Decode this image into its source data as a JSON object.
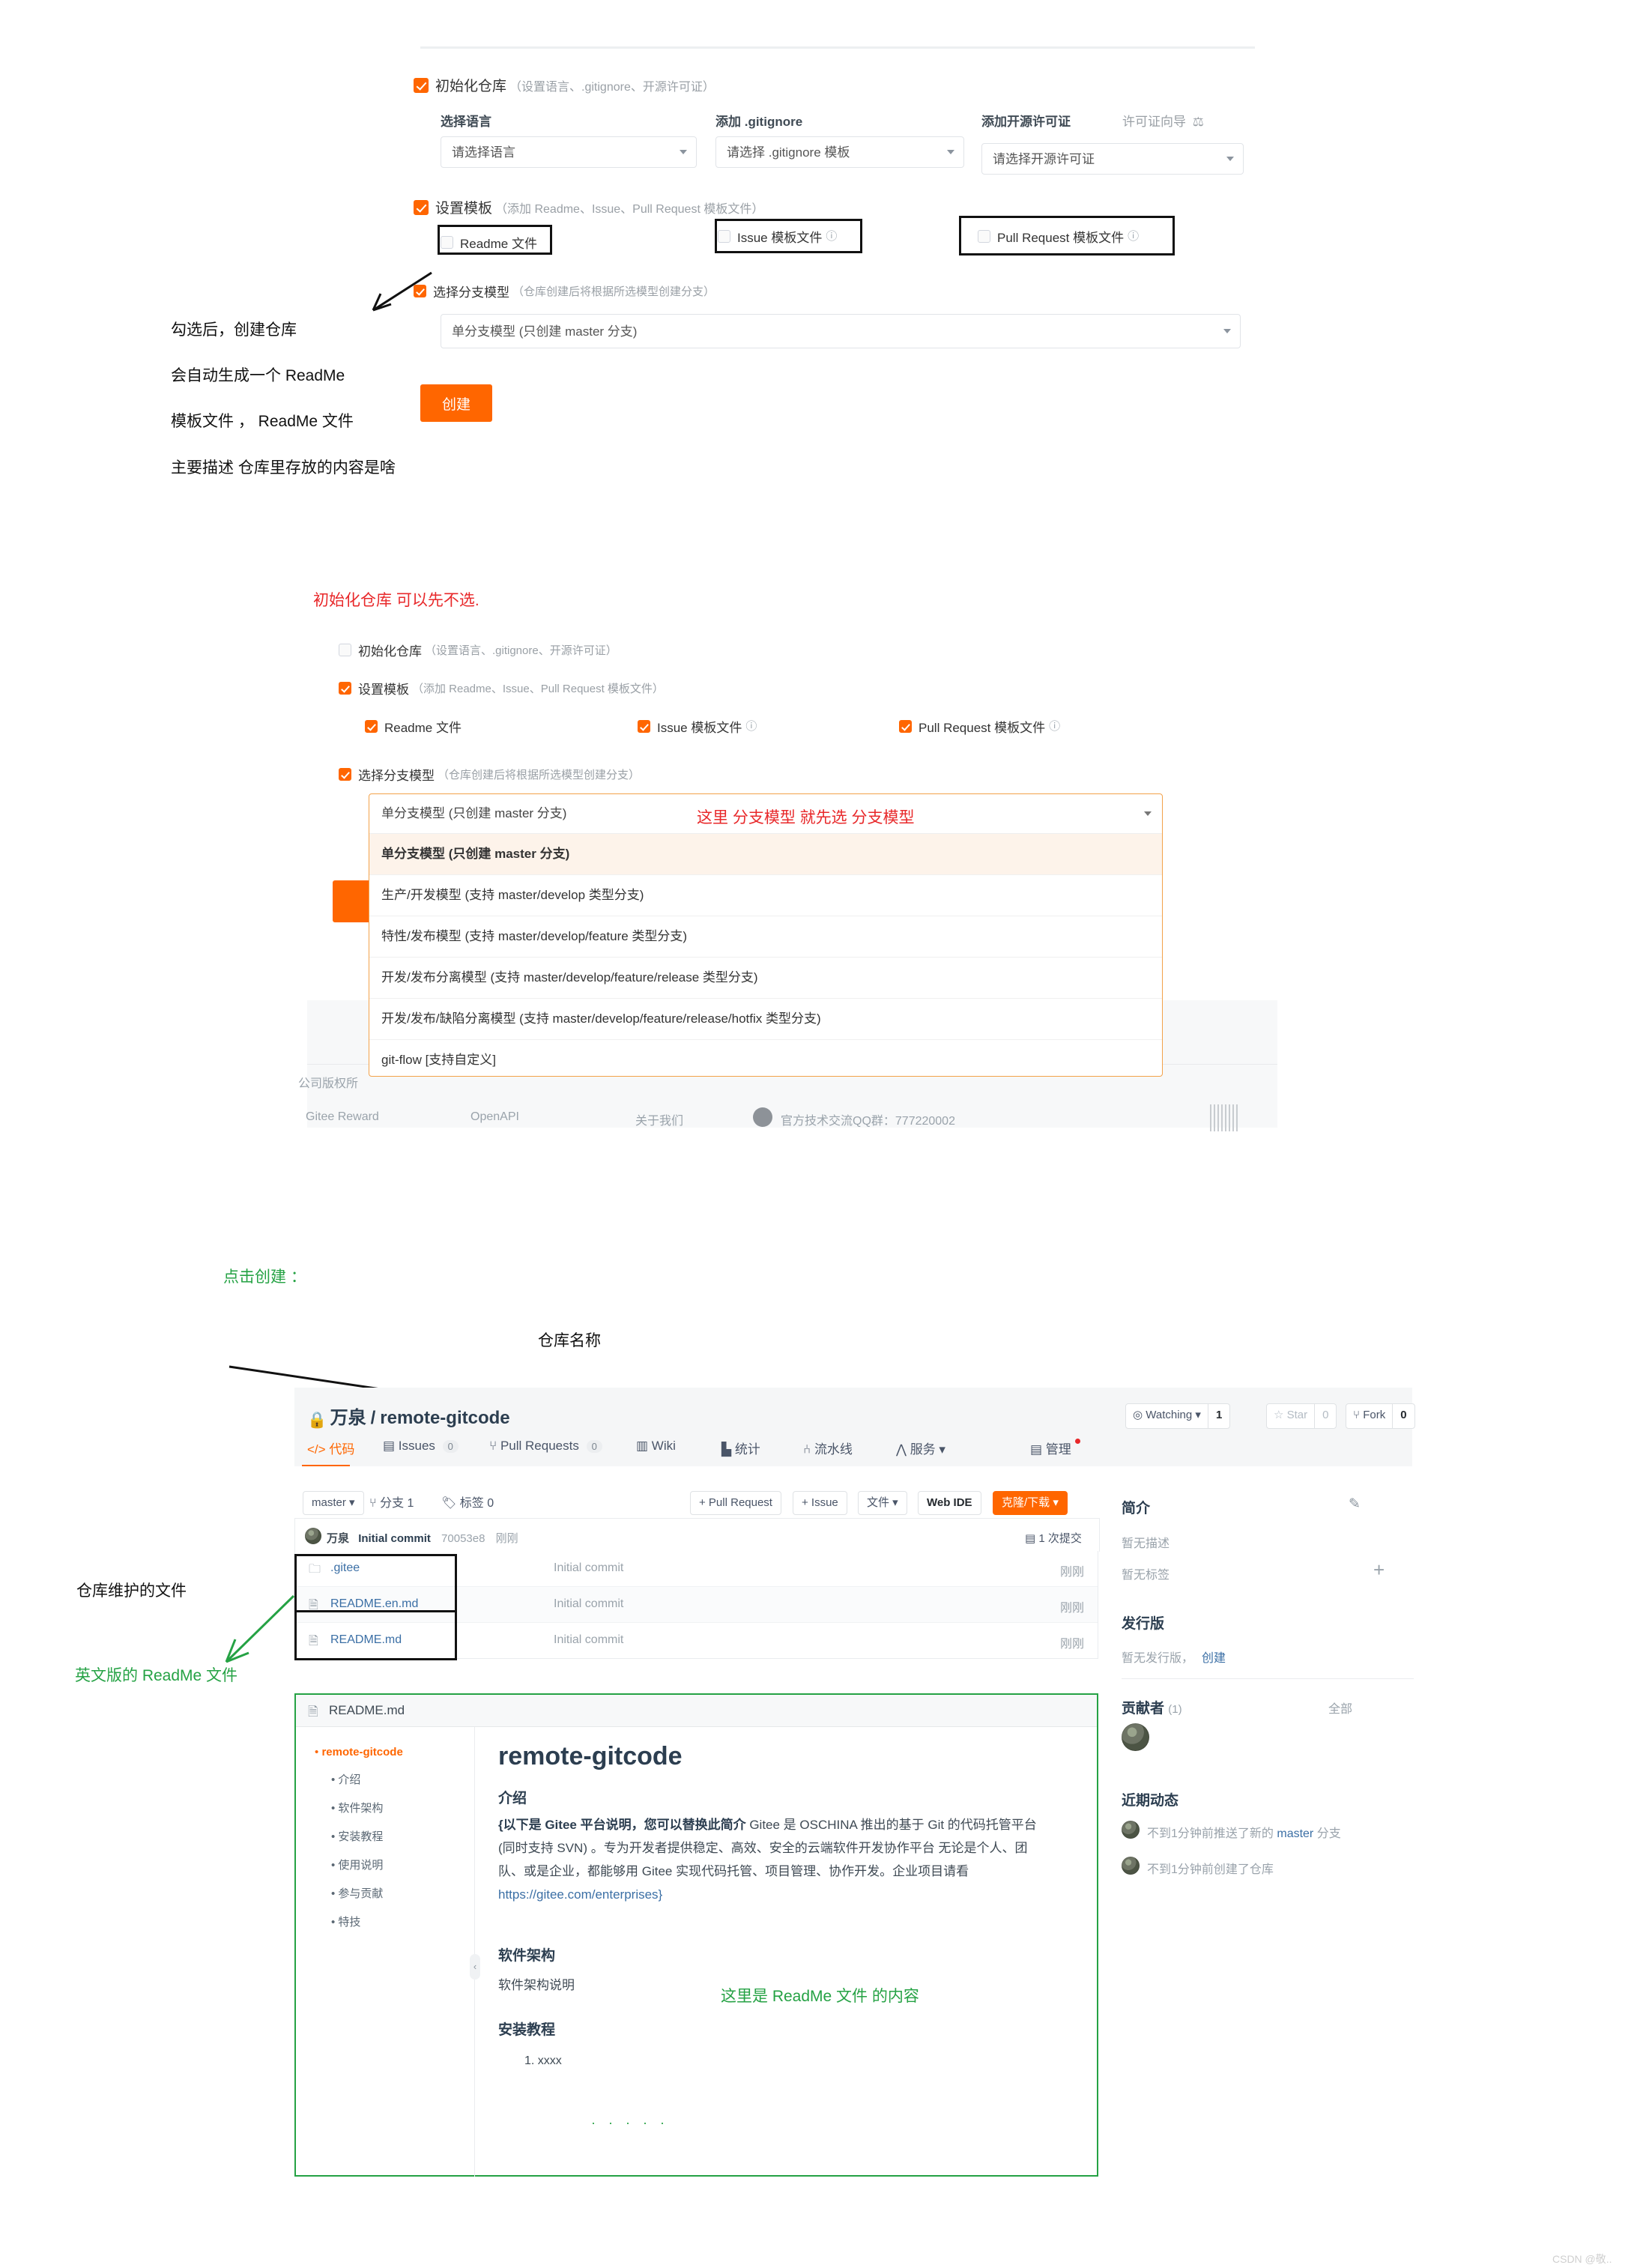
{
  "section1": {
    "init_repo": {
      "label": "初始化仓库",
      "hint": "（设置语言、.gitignore、开源许可证）",
      "checked": true
    },
    "fields": [
      {
        "title": "选择语言",
        "value": "请选择语言"
      },
      {
        "title": "添加 .gitignore",
        "value": "请选择 .gitignore 模板"
      },
      {
        "title": "添加开源许可证",
        "value": "请选择开源许可证",
        "extra": "许可证向导"
      }
    ],
    "set_template": {
      "label": "设置模板",
      "hint": "（添加 Readme、Issue、Pull Request 模板文件）",
      "checked": true
    },
    "template_options": [
      {
        "label": "Readme 文件",
        "checked": false,
        "help": false
      },
      {
        "label": "Issue 模板文件",
        "checked": false,
        "help": true
      },
      {
        "label": "Pull Request 模板文件",
        "checked": false,
        "help": true
      }
    ],
    "branch_model": {
      "label": "选择分支模型",
      "hint": "（仓库创建后将根据所选模型创建分支）",
      "checked": true
    },
    "branch_select_value": "单分支模型 (只创建 master 分支)",
    "create_button": "创建",
    "annotations": [
      "勾选后，创建仓库",
      "会自动生成一个 ReadMe",
      "模板文件 ， ReadMe 文件",
      "主要描述 仓库里存放的内容是啥"
    ]
  },
  "section2": {
    "note_red_top": "初始化仓库 可以先不选.",
    "note_red_inline": "这里 分支模型 就先选 分支模型",
    "init_repo": {
      "label": "初始化仓库",
      "hint": "（设置语言、.gitignore、开源许可证）",
      "checked": false
    },
    "set_template": {
      "label": "设置模板",
      "hint": "（添加 Readme、Issue、Pull Request 模板文件）",
      "checked": true
    },
    "template_options": [
      {
        "label": "Readme 文件",
        "checked": true,
        "help": false
      },
      {
        "label": "Issue 模板文件",
        "checked": true,
        "help": true
      },
      {
        "label": "Pull Request 模板文件",
        "checked": true,
        "help": true
      }
    ],
    "branch_model": {
      "label": "选择分支模型",
      "hint": "（仓库创建后将根据所选模型创建分支）",
      "checked": true
    },
    "dropdown_value": "单分支模型 (只创建 master 分支)",
    "dropdown_items": [
      "单分支模型 (只创建 master 分支)",
      "生产/开发模型 (支持 master/develop 类型分支)",
      "特性/发布模型 (支持 master/develop/feature 类型分支)",
      "开发/发布分离模型 (支持 master/develop/feature/release 类型分支)",
      "开发/发布/缺陷分离模型 (支持 master/develop/feature/release/hotfix 类型分支)",
      "git-flow [支持自定义]"
    ],
    "footer_copyright": "公司版权所",
    "footer_links": [
      "Gitee Reward",
      "OpenAPI",
      "关于我们"
    ],
    "footer_qq": "官方技术交流QQ群：777220002"
  },
  "section3": {
    "note_click_create": "点击创建 ：",
    "note_repo_name": "仓库名称",
    "note_repo_files": "仓库维护的文件",
    "note_en_readme": "英文版的 ReadMe 文件",
    "note_readme_content": "这里是 ReadMe 文件 的内容",
    "repo": {
      "owner": "万泉",
      "separator": "/",
      "name": "remote-gitcode",
      "watching_label": "Watching",
      "watching_count": "1",
      "star_label": "Star",
      "star_count": "0",
      "fork_label": "Fork",
      "fork_count": "0"
    },
    "tabs": [
      {
        "label": "代码",
        "count": null,
        "active": true
      },
      {
        "label": "Issues",
        "count": "0",
        "active": false
      },
      {
        "label": "Pull Requests",
        "count": "0",
        "active": false
      },
      {
        "label": "Wiki",
        "count": null,
        "active": false
      },
      {
        "label": "统计",
        "count": null,
        "active": false
      },
      {
        "label": "流水线",
        "count": null,
        "active": false
      },
      {
        "label": "服务",
        "count": null,
        "active": false
      },
      {
        "label": "管理",
        "count": null,
        "active": false
      }
    ],
    "toolbar": {
      "branch": "master",
      "branches": "分支 1",
      "tags": "标签 0",
      "pull_request": "+ Pull Request",
      "issue": "+ Issue",
      "files": "文件",
      "webide": "Web IDE",
      "clone": "克隆/下载"
    },
    "commit": {
      "author": "万泉",
      "message": "Initial commit",
      "sha": "70053e8",
      "time": "刚刚",
      "count": "1 次提交"
    },
    "files": [
      {
        "name": ".gitee",
        "type": "folder",
        "message": "Initial commit",
        "time": "刚刚"
      },
      {
        "name": "README.en.md",
        "type": "file",
        "message": "Initial commit",
        "time": "刚刚"
      },
      {
        "name": "README.md",
        "type": "file",
        "message": "Initial commit",
        "time": "刚刚"
      }
    ],
    "sidebar": {
      "intro_title": "简介",
      "no_description": "暂无描述",
      "no_tags": "暂无标签",
      "release_title": "发行版",
      "no_release": "暂无发行版，",
      "release_create": "创建",
      "contributors_title": "贡献者",
      "contributors_count": "(1)",
      "contributors_all": "全部",
      "activity_title": "近期动态",
      "activity": [
        {
          "pre": "不到1分钟前推送了新的 ",
          "link": "master",
          "post": " 分支"
        },
        {
          "pre": "不到1分钟前创建了仓库",
          "link": "",
          "post": ""
        }
      ]
    },
    "readme": {
      "filename": "README.md",
      "toc": [
        "remote-gitcode",
        "介绍",
        "软件架构",
        "安装教程",
        "使用说明",
        "参与贡献",
        "特技"
      ],
      "h1": "remote-gitcode",
      "h2_intro": "介绍",
      "intro_bold": "{以下是 Gitee 平台说明，您可以替换此简介 ",
      "intro_body": "Gitee 是 OSCHINA 推出的基于 Git 的代码托管平台 (同时支持 SVN) 。专为开发者提供稳定、高效、安全的云端软件开发协作平台 无论是个人、团队、或是企业，都能够用 Gitee 实现代码托管、项目管理、协作开发。企业项目请看 ",
      "intro_link": "https://gitee.com/enterprises}",
      "h2_arch": "软件架构",
      "arch_body": "软件架构说明",
      "h2_install": "安装教程",
      "install_item": "1. xxxx",
      "dots": "· · · · ·"
    }
  },
  "watermark": "CSDN @敬.."
}
